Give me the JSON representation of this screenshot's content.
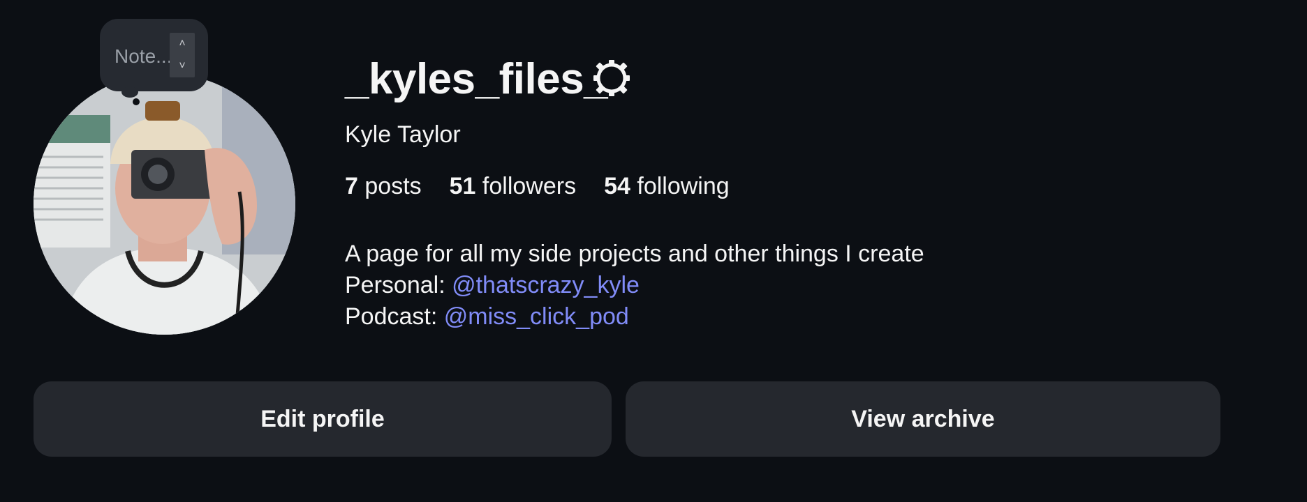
{
  "note": {
    "placeholder": "Note...",
    "stepper_up": "˄",
    "stepper_down": "˅"
  },
  "profile": {
    "username": "_kyles_files_",
    "full_name": "Kyle Taylor",
    "avatar_icon": "profile-photo",
    "settings_icon": "gear-icon"
  },
  "stats": {
    "posts_count": "7",
    "posts_label": "posts",
    "followers_count": "51",
    "followers_label": "followers",
    "following_count": "54",
    "following_label": "following"
  },
  "bio": {
    "line1": "A page for all my side projects and other things I create",
    "personal_label": "Personal: ",
    "personal_handle": "@thatscrazy_kyle",
    "podcast_label": "Podcast: ",
    "podcast_handle": "@miss_click_pod"
  },
  "actions": {
    "edit_profile": "Edit profile",
    "view_archive": "View archive"
  },
  "colors": {
    "background": "#0c0f14",
    "button_bg": "#25282e",
    "mention": "#818cf8",
    "text": "#f5f5f5"
  }
}
